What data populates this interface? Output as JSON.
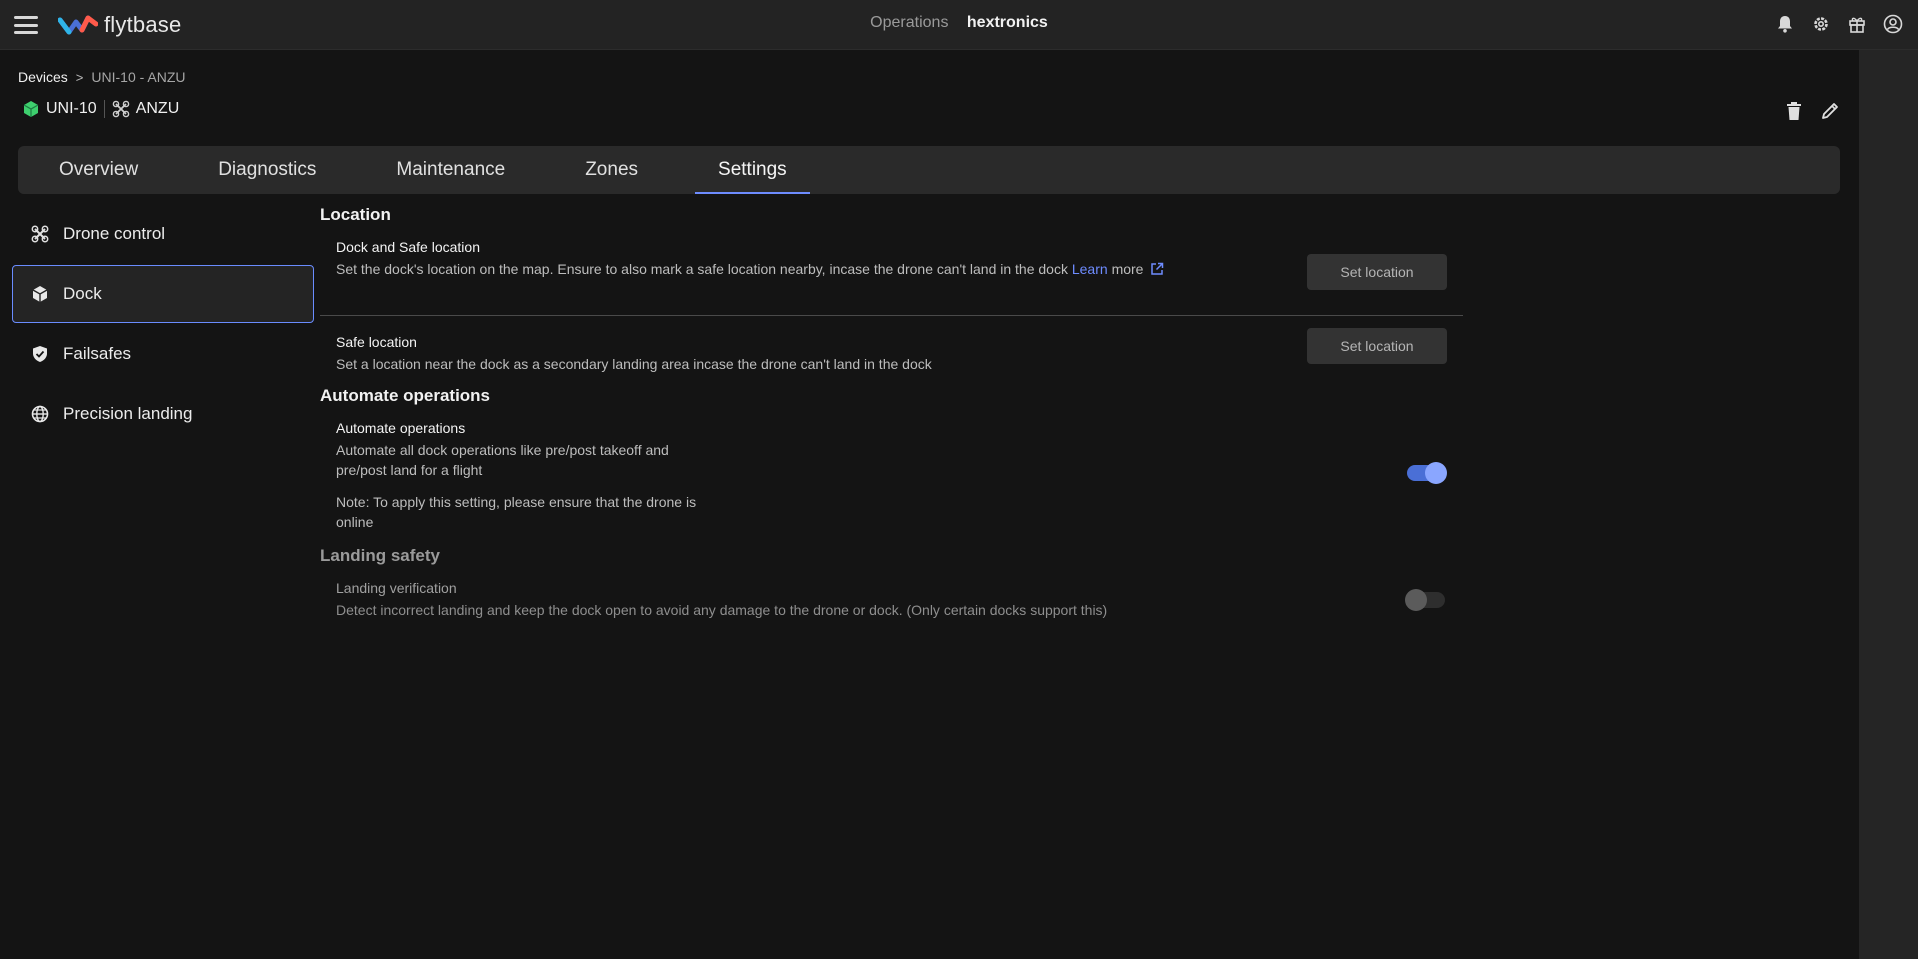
{
  "header": {
    "brand": "flytbase",
    "nav_operations": "Operations",
    "nav_org": "hextronics"
  },
  "breadcrumb": {
    "root": "Devices",
    "separator": ">",
    "current": "UNI-10 - ANZU"
  },
  "device": {
    "dock_name": "UNI-10",
    "drone_name": "ANZU"
  },
  "tabs": [
    {
      "label": "Overview"
    },
    {
      "label": "Diagnostics"
    },
    {
      "label": "Maintenance"
    },
    {
      "label": "Zones"
    },
    {
      "label": "Settings"
    }
  ],
  "sidebar": {
    "items": [
      {
        "label": "Drone control"
      },
      {
        "label": "Dock"
      },
      {
        "label": "Failsafes"
      },
      {
        "label": "Precision landing"
      }
    ]
  },
  "location": {
    "title": "Location",
    "dock_safe": {
      "title": "Dock and Safe location",
      "desc": "Set the dock's location on the map. Ensure to also mark a safe location nearby, incase the drone can't land in the dock",
      "link_learn": "Learn",
      "link_more": "more",
      "button": "Set location"
    },
    "safe": {
      "title": "Safe location",
      "desc": "Set a location near the dock as a secondary landing area incase the drone can't land in the dock",
      "button": "Set location"
    }
  },
  "automate": {
    "section_title": "Automate operations",
    "title": "Automate operations",
    "desc_line1": "Automate all dock operations like pre/post takeoff and",
    "desc_line2": "pre/post land for a flight",
    "note_line1": "Note: To apply this setting, please ensure that the drone is",
    "note_line2": "online",
    "enabled": true
  },
  "landing_safety": {
    "section_title": "Landing safety",
    "title": "Landing verification",
    "desc": "Detect incorrect landing and keep the dock open to avoid any damage to the drone or dock. (Only certain docks support this)",
    "enabled": false
  },
  "colors": {
    "accent": "#6e8cff",
    "dock_green": "#3ecf6e"
  }
}
